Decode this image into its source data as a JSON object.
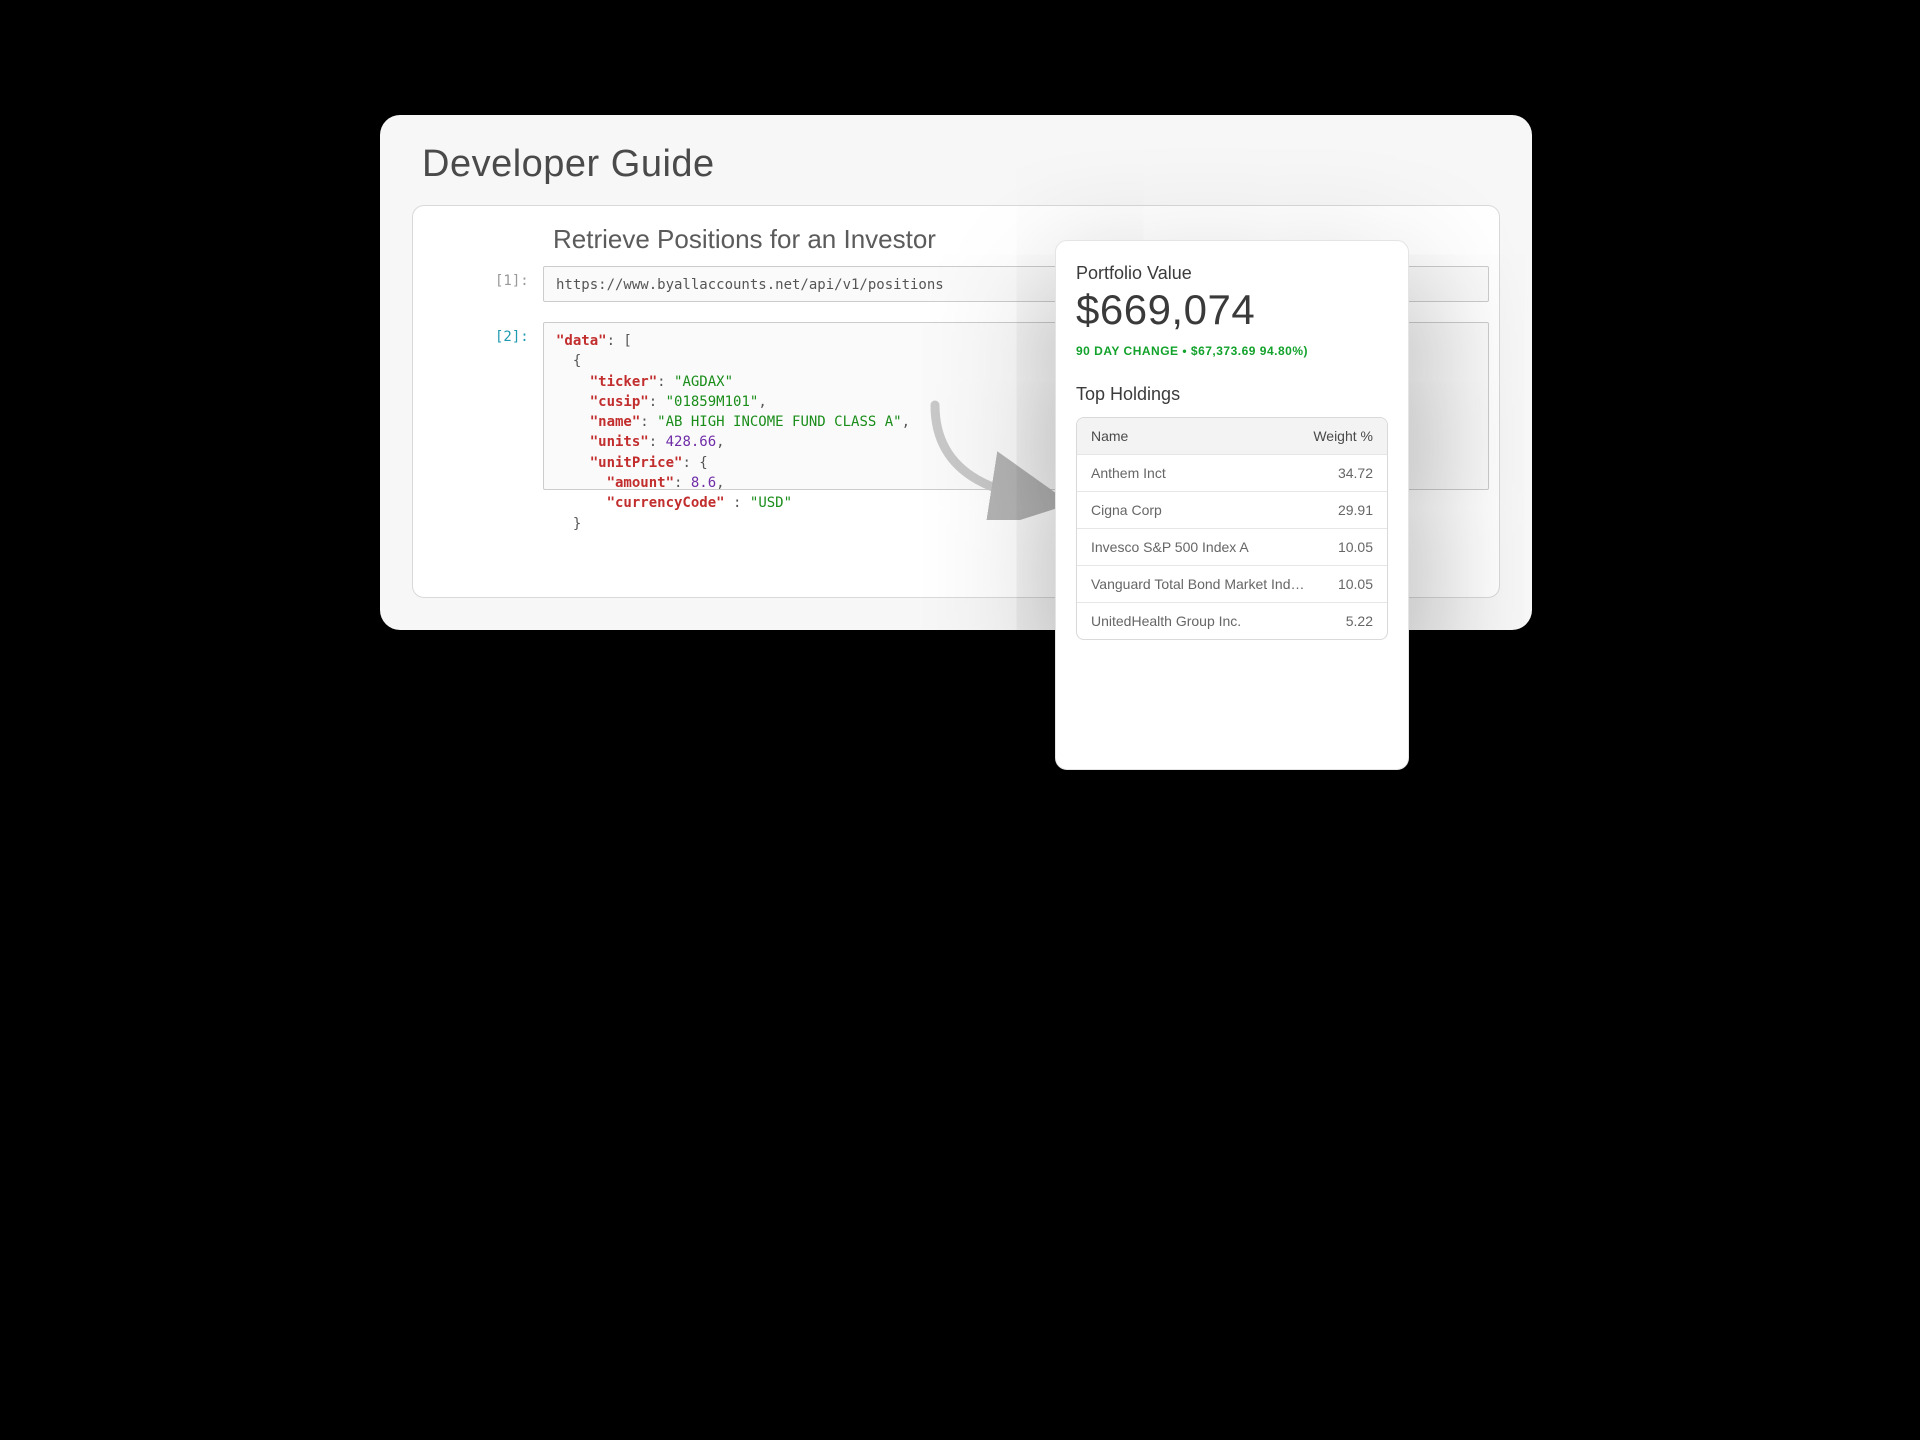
{
  "back": {
    "title": "Developer Guide",
    "section_title": "Retrieve Positions for an Investor",
    "prompt1": "[1]:",
    "prompt2": "[2]:",
    "cell1_text": "https://www.byallaccounts.net/api/v1/positions",
    "code": {
      "k_data": "\"data\"",
      "k_ticker": "\"ticker\"",
      "v_ticker": "\"AGDAX\"",
      "k_cusip": "\"cusip\"",
      "v_cusip": "\"01859M101\"",
      "k_name": "\"name\"",
      "v_name": "\"AB HIGH INCOME FUND CLASS A\"",
      "k_units": "\"units\"",
      "v_units": "428.66",
      "k_unitPrice": "\"unitPrice\"",
      "k_amount": "\"amount\"",
      "v_amount": "8.6",
      "k_curr": "\"currencyCode\"",
      "v_curr": "\"USD\""
    }
  },
  "front": {
    "portfolio_label": "Portfolio Value",
    "portfolio_value": "$669,074",
    "change_line": "90 DAY CHANGE • $67,373.69 94.80%)",
    "holdings_title": "Top Holdings",
    "col_name": "Name",
    "col_weight": "Weight %",
    "rows": [
      {
        "name": "Anthem Inct",
        "weight": "34.72"
      },
      {
        "name": "Cigna Corp",
        "weight": "29.91"
      },
      {
        "name": "Invesco S&P 500 Index A",
        "weight": "10.05"
      },
      {
        "name": "Vanguard Total Bond Market Index",
        "weight": "10.05"
      },
      {
        "name": "UnitedHealth Group Inc.",
        "weight": "5.22"
      }
    ]
  }
}
